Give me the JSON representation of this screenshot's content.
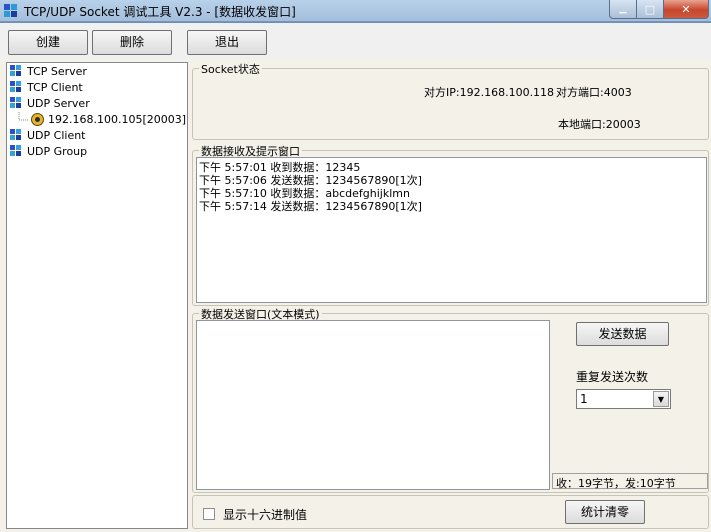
{
  "window": {
    "title": "TCP/UDP Socket 调试工具 V2.3 - [数据收发窗口]",
    "minimize_glyph": "▁",
    "maximize_glyph": "□",
    "close_glyph": "✕"
  },
  "toolbar": {
    "create_label": "创建",
    "delete_label": "删除",
    "exit_label": "退出"
  },
  "tree": {
    "items": [
      {
        "label": "TCP Server"
      },
      {
        "label": "TCP Client"
      },
      {
        "label": "UDP Server"
      },
      {
        "label": "192.168.100.105[20003]"
      },
      {
        "label": "UDP Client"
      },
      {
        "label": "UDP Group"
      }
    ]
  },
  "socket_status": {
    "title": "Socket状态",
    "remote_ip": "对方IP:192.168.100.118",
    "remote_port": "对方端口:4003",
    "local_port": "本地端口:20003"
  },
  "receive": {
    "title": "数据接收及提示窗口",
    "lines": [
      "下午 5:57:01 收到数据：12345",
      "下午 5:57:06 发送数据：1234567890[1次]",
      "下午 5:57:10 收到数据：abcdefghijklmn",
      "下午 5:57:14 发送数据：1234567890[1次]"
    ]
  },
  "send": {
    "title": "数据发送窗口(文本模式)",
    "send_button": "发送数据",
    "repeat_label": "重复发送次数",
    "repeat_value": "1",
    "stats": "收：19字节，发:10字节"
  },
  "footer": {
    "hex_label": "显示十六进制值",
    "clear_stats_button": "统计清零"
  },
  "colors": {
    "titlebar": "#b9d1ea",
    "client_bg": "#f4f2e8",
    "close_button": "#c9462c"
  }
}
